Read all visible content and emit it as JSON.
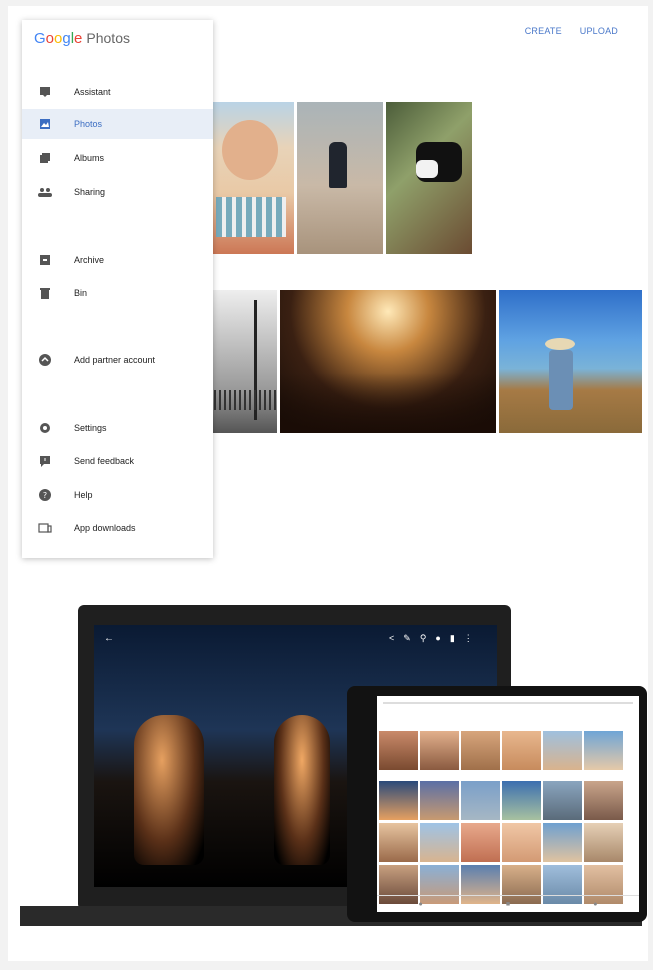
{
  "app": {
    "logo_letters": [
      "G",
      "o",
      "o",
      "g",
      "l",
      "e"
    ],
    "logo_suffix": "Photos"
  },
  "topbar": {
    "create": "CREATE",
    "upload": "UPLOAD"
  },
  "nav": [
    {
      "label": "Assistant",
      "icon": "assistant-icon"
    },
    {
      "label": "Photos",
      "icon": "photos-icon",
      "active": true
    },
    {
      "label": "Albums",
      "icon": "albums-icon"
    },
    {
      "label": "Sharing",
      "icon": "sharing-icon"
    },
    {
      "label": "Archive",
      "icon": "archive-icon"
    },
    {
      "label": "Bin",
      "icon": "bin-icon"
    },
    {
      "label": "Add partner account",
      "icon": "partner-account-icon"
    },
    {
      "label": "Settings",
      "icon": "settings-icon"
    },
    {
      "label": "Send feedback",
      "icon": "feedback-icon"
    },
    {
      "label": "Help",
      "icon": "help-icon"
    },
    {
      "label": "App downloads",
      "icon": "app-downloads-icon"
    }
  ],
  "colors": {
    "active_bg": "#e8eef7",
    "active_text": "#3b6dc2",
    "accent": "#4a78c9"
  }
}
